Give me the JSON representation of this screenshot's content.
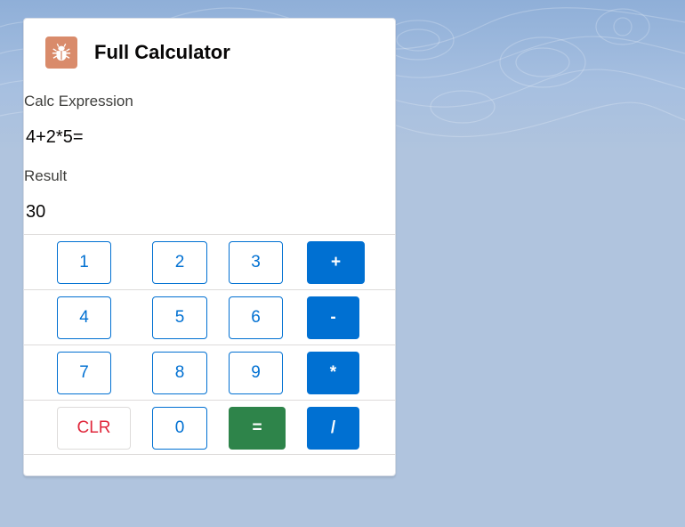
{
  "card": {
    "title": "Full Calculator",
    "icon": "bug-icon",
    "icon_color": "#d98b6b"
  },
  "expression": {
    "label": "Calc Expression",
    "value": "4+2*5="
  },
  "result": {
    "label": "Result",
    "value": "30"
  },
  "keypad": {
    "rows": [
      [
        "1",
        "2",
        "3",
        "+"
      ],
      [
        "4",
        "5",
        "6",
        "-"
      ],
      [
        "7",
        "8",
        "9",
        "*"
      ],
      [
        "CLR",
        "0",
        "=",
        "/"
      ]
    ]
  },
  "colors": {
    "brand": "#0070d2",
    "success": "#2e844a",
    "destructive": "#e0283c"
  }
}
